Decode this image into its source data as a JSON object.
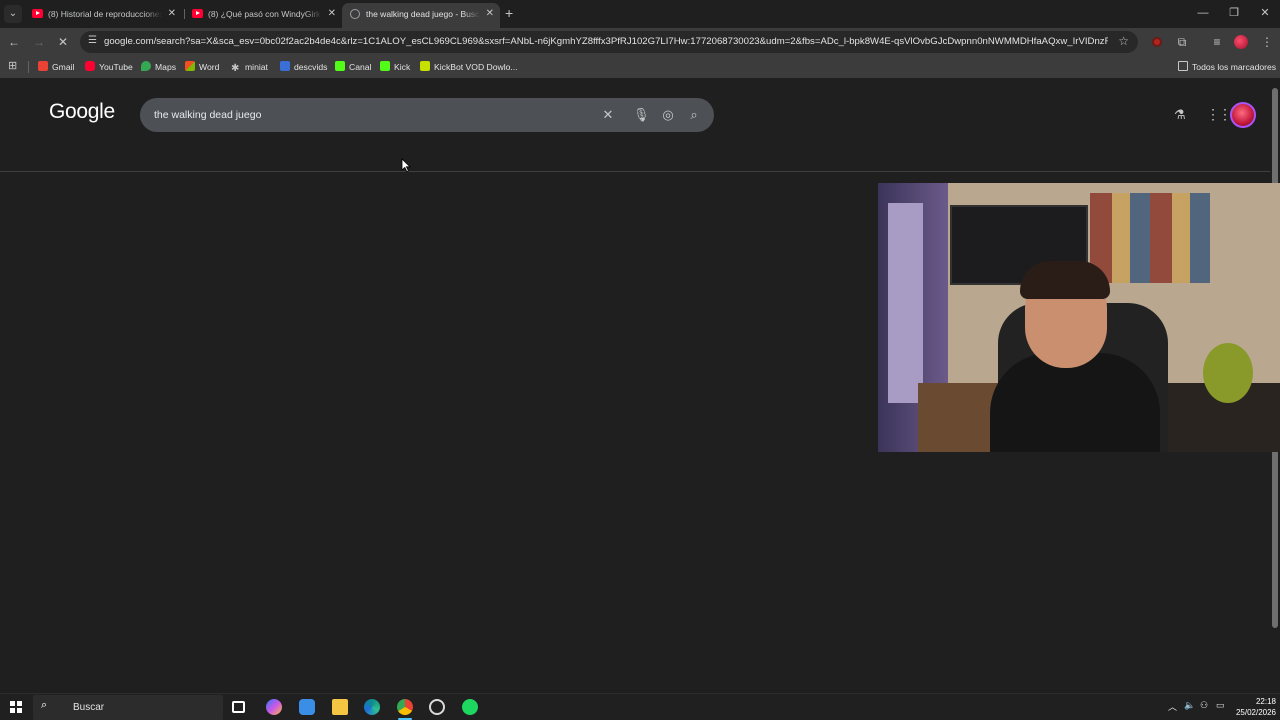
{
  "browser": {
    "tabs": [
      {
        "title": "(8) Historial de reproducciones",
        "active": false
      },
      {
        "title": "(8) ¿Qué pasó con WindyGirk?",
        "active": false
      },
      {
        "title": "the walking dead juego - Buscar",
        "active": true
      }
    ],
    "url": "google.com/search?sa=X&sca_esv=0bc02f2ac2b4de4c&rlz=1C1ALOY_esCL969CL969&sxsrf=ANbL-n6jKgmhYZ8fffx3PfRJ102G7LI7Hw:1772068730023&udm=2&fbs=ADc_l-bpk8W4E-qsVlOvbGJcDwpnn0nNWMMDHfaAQxw_IrVIDnzRukPeQewl...",
    "bookmarks": [
      "Gmail",
      "YouTube",
      "Maps",
      "Word",
      "miniat",
      "descvids",
      "Canal",
      "Kick",
      "KickBot VOD Dowlo..."
    ],
    "all_bookmarks_label": "Todos los marcadores"
  },
  "google": {
    "logo": "Google",
    "query": "the walking dead juego"
  },
  "taskbar": {
    "search_label": "Buscar",
    "time": "22:18",
    "date": "25/02/2026"
  }
}
